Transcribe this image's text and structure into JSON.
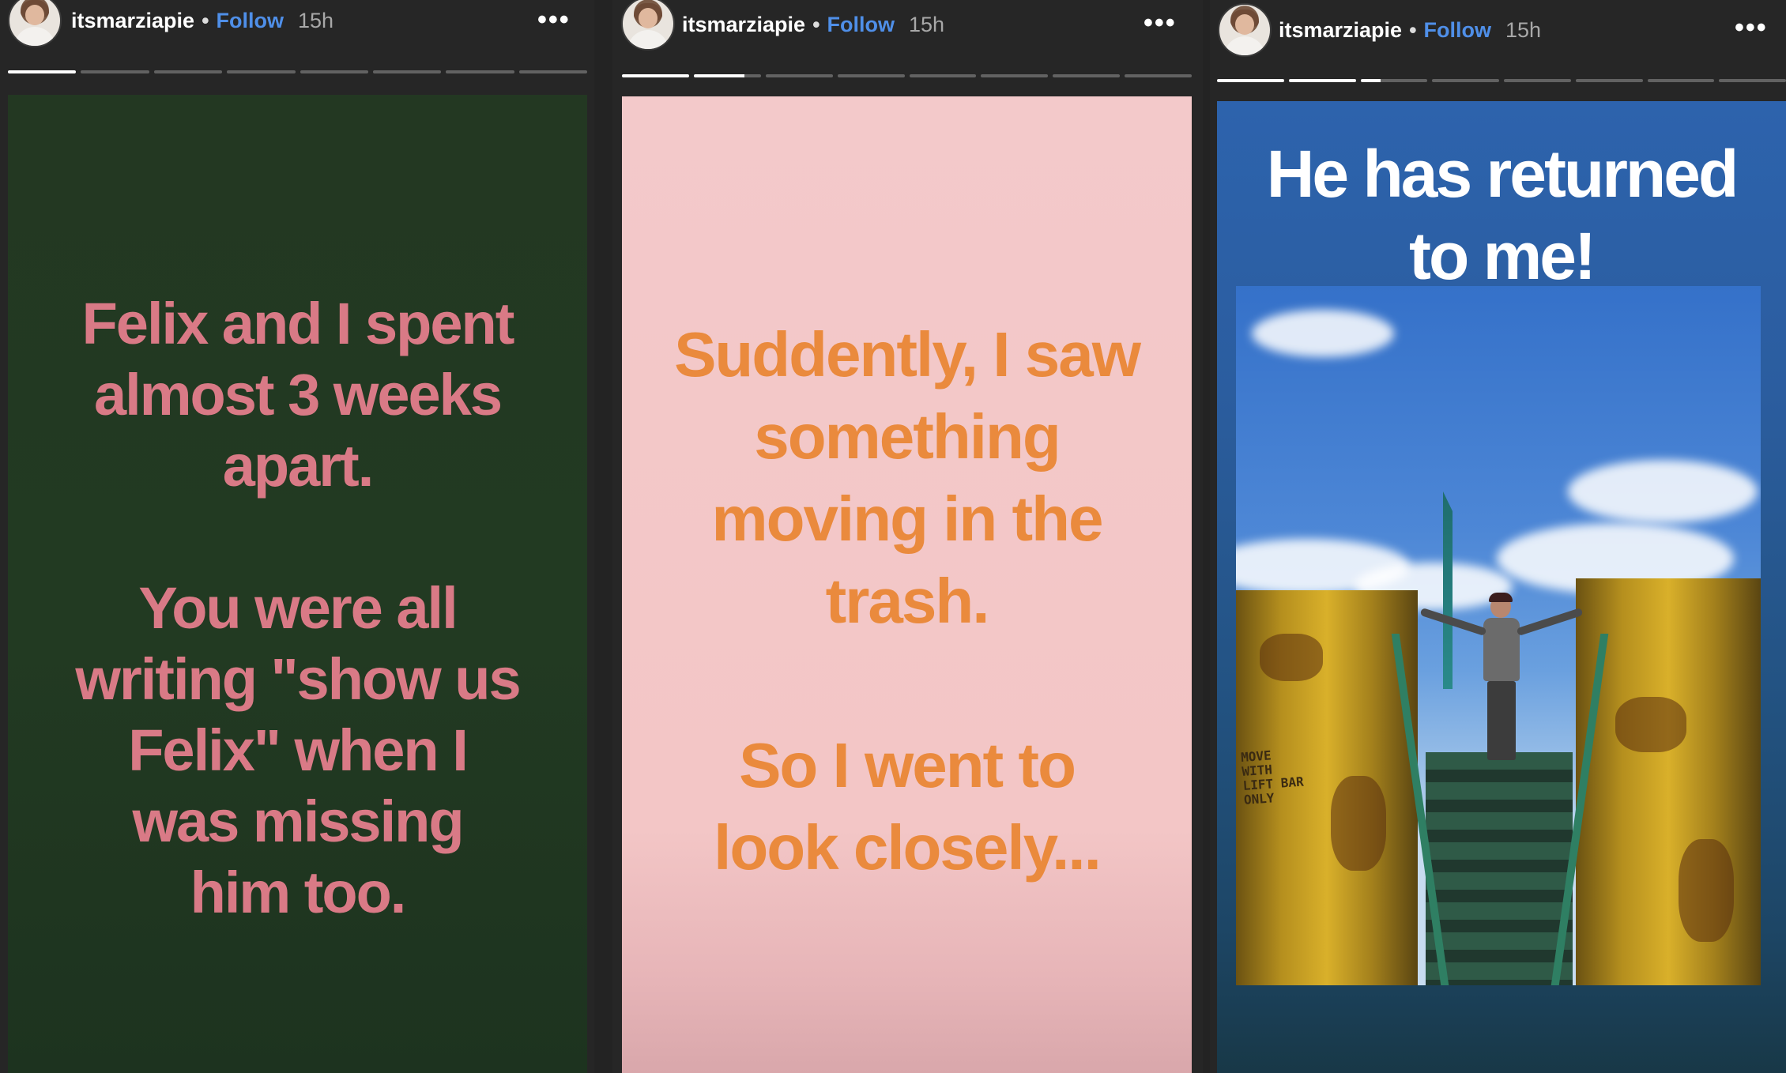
{
  "stories": [
    {
      "username": "itsmarziapie",
      "separator": "•",
      "follow_label": "Follow",
      "time": "15h",
      "more_icon": "•••",
      "progress": [
        1,
        0,
        0,
        0,
        0,
        0,
        0,
        0
      ],
      "background_color": "#233822",
      "text_color": "#d97a86",
      "text_lines": [
        "Felix and I spent",
        "almost 3 weeks",
        "apart.",
        "",
        "You were all",
        "writing \"show us",
        "Felix\" when I",
        "was missing",
        "him too."
      ]
    },
    {
      "username": "itsmarziapie",
      "separator": "•",
      "follow_label": "Follow",
      "time": "15h",
      "more_icon": "•••",
      "progress": [
        1,
        0.75,
        0,
        0,
        0,
        0,
        0,
        0
      ],
      "background_color": "#f3c9ca",
      "text_color": "#ea8a3d",
      "text_lines": [
        "Suddently, I saw",
        "something",
        "moving in the",
        "trash.",
        "",
        "So I went to",
        "look closely..."
      ]
    },
    {
      "username": "itsmarziapie",
      "separator": "•",
      "follow_label": "Follow",
      "time": "15h",
      "more_icon": "•••",
      "progress": [
        1,
        1,
        0.3,
        0,
        0,
        0,
        0,
        0
      ],
      "background_color": "#2d63ad",
      "text_color": "#ffffff",
      "text_lines": [
        "He has returned",
        "to me!"
      ],
      "photo_sign_lines": [
        "MOVE WITH",
        "LIFT BAR",
        "ONLY"
      ]
    }
  ]
}
